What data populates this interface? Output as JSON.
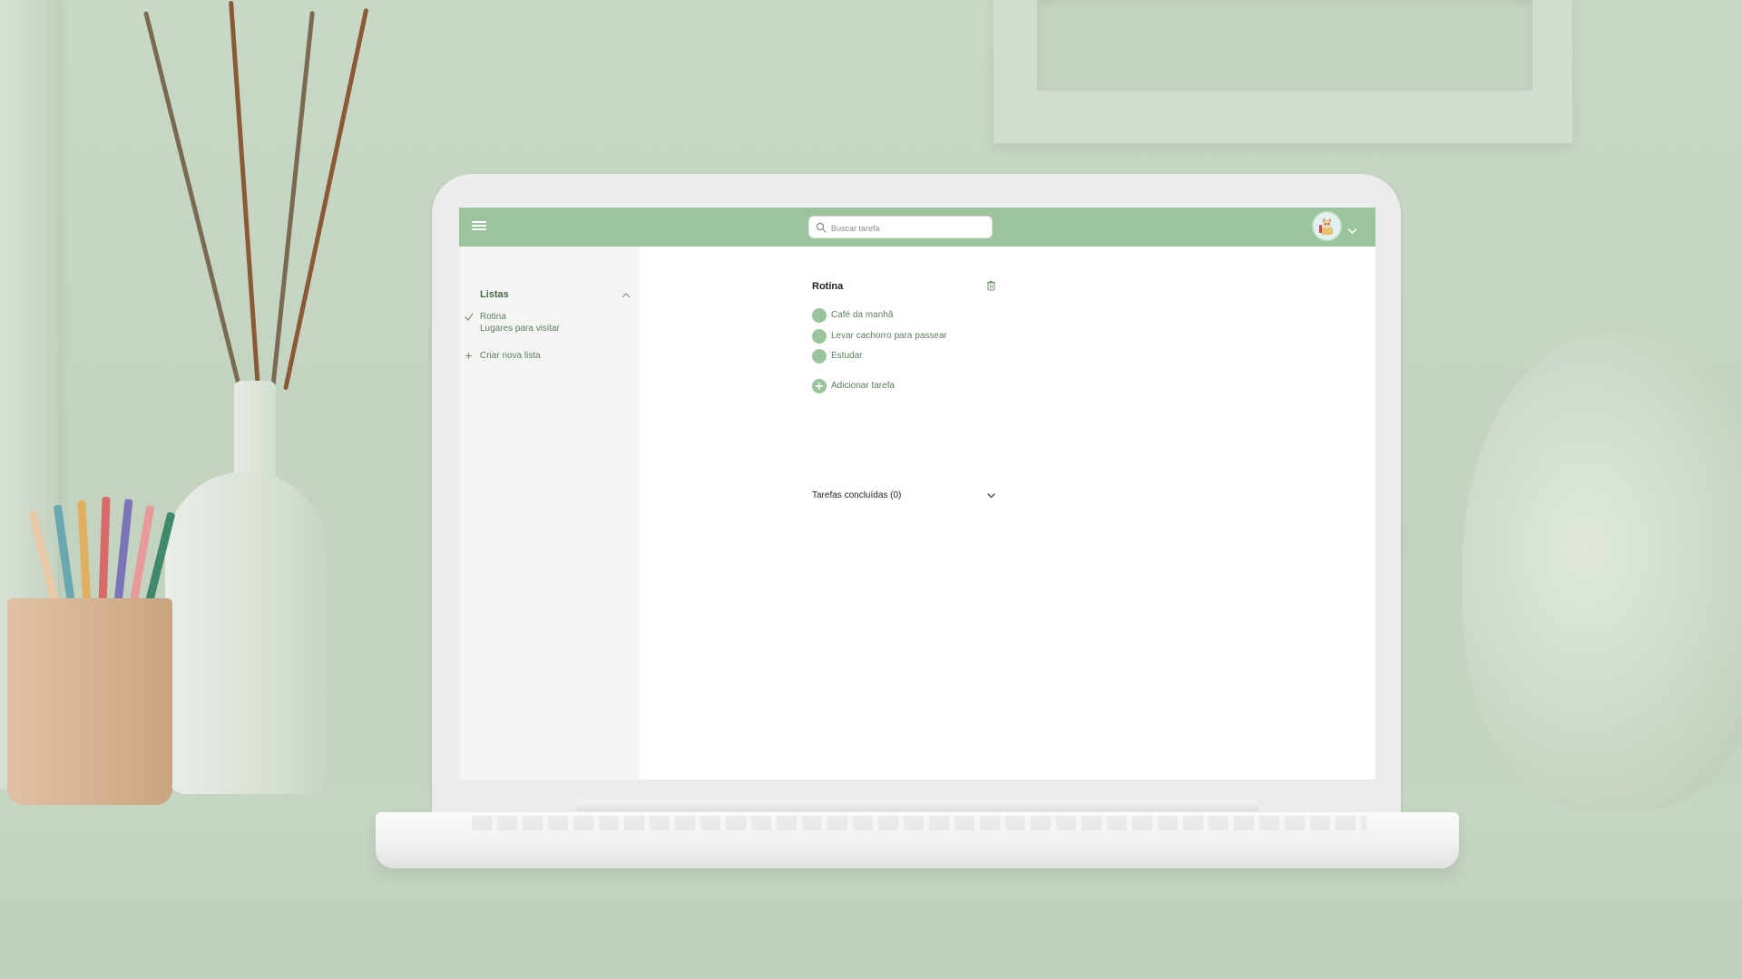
{
  "header": {
    "menu_icon": "hamburger-menu-icon",
    "search_placeholder": "Buscar tarefa",
    "search_icon": "search-icon",
    "avatar_icon": "user-avatar-icon",
    "account_menu_icon": "chevron-down-icon",
    "color": "#9cc49c"
  },
  "sidebar": {
    "title": "Listas",
    "collapse_icon": "chevron-up-icon",
    "items": [
      {
        "label": "Rotina",
        "selected": true,
        "icon": "check-icon"
      },
      {
        "label": "Lugares para visitar",
        "selected": false
      }
    ],
    "create_label": "Criar nova lista",
    "create_icon": "plus-icon"
  },
  "main": {
    "list_title": "Rotina",
    "delete_icon": "trash-icon",
    "tasks": [
      {
        "label": "Café da manhã"
      },
      {
        "label": "Levar cachorro para passear"
      },
      {
        "label": "Estudar"
      }
    ],
    "add_task_label": "Adicionar tarefa",
    "add_task_icon": "plus-circle-icon",
    "completed_label": "Tarefas concluídas (0)",
    "completed_toggle_icon": "chevron-down-icon"
  },
  "colors": {
    "accent": "#9cc49c",
    "sidebar_bg": "#f4f5f3",
    "text_green": "#5f7d5f"
  }
}
